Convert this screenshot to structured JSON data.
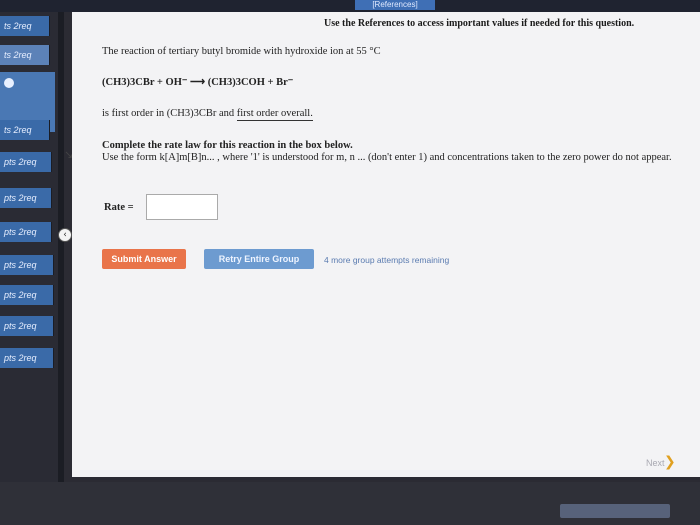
{
  "header": {
    "references_tab": "[References]"
  },
  "sidebar": {
    "items": [
      {
        "label": "ts 2req"
      },
      {
        "label": "ts 2req"
      },
      {
        "label": "ts 2req"
      },
      {
        "label": "pts 2req"
      },
      {
        "label": "pts 2req"
      },
      {
        "label": "pts 2req"
      },
      {
        "label": "pts 2req"
      },
      {
        "label": "pts 2req"
      },
      {
        "label": "pts 2req"
      },
      {
        "label": "pts 2req"
      }
    ],
    "collapse_icon": "chevron-left-icon"
  },
  "question": {
    "reference_note": "Use the References to access important values if needed for this question.",
    "intro": "The reaction of tertiary butyl bromide with hydroxide ion at 55 °C",
    "equation": "(CH3)3CBr + OH⁻ ⟶ (CH3)3COH + Br⁻",
    "order_prefix": "is first order in (CH3)3CBr and ",
    "order_suffix": "first order overall.",
    "instruction_heading": "Complete the rate law for this reaction in the box below.",
    "instruction_body": "Use the form k[A]m[B]n... , where '1' is understood for m, n ... (don't enter 1) and concentrations taken to the zero power do not appear.",
    "rate_label": "Rate =",
    "rate_value": ""
  },
  "actions": {
    "submit": "Submit Answer",
    "retry": "Retry Entire Group",
    "attempts": "4 more group attempts remaining",
    "next": "Next"
  },
  "colors": {
    "submit": "#e9744a",
    "retry": "#6d9bd0",
    "nav": "#3a6aa8"
  }
}
